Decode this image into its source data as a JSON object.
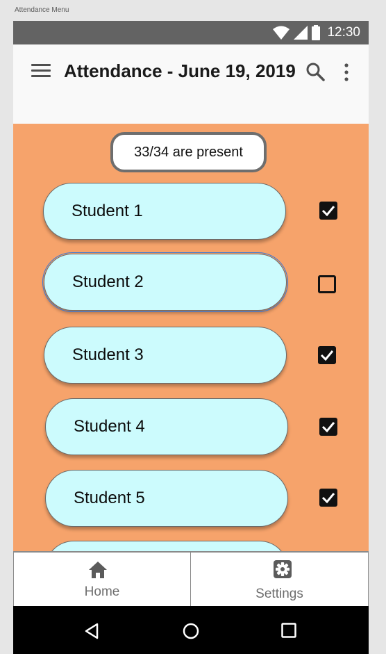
{
  "frame": {
    "label": "Attendance Menu"
  },
  "status_bar": {
    "time": "12:30"
  },
  "app_bar": {
    "title": "Attendance - June 19, 2019"
  },
  "summary": {
    "text": "33/34 are present"
  },
  "students": [
    {
      "name": "Student 1",
      "present": true
    },
    {
      "name": "Student 2",
      "present": false
    },
    {
      "name": "Student 3",
      "present": true
    },
    {
      "name": "Student 4",
      "present": true
    },
    {
      "name": "Student 5",
      "present": true
    }
  ],
  "bottom_nav": {
    "home_label": "Home",
    "settings_label": "Settings"
  },
  "colors": {
    "content_bg": "#f6a36b",
    "card_bg": "#ccfbfd",
    "status_bar": "#636363",
    "system_nav": "#000000"
  },
  "icons": {
    "menu": "hamburger-icon",
    "search": "search-icon",
    "more": "more-vert-icon",
    "home": "home-icon",
    "settings": "gear-icon",
    "back": "back-triangle-icon",
    "home_sys": "circle-icon",
    "recents": "square-icon"
  }
}
